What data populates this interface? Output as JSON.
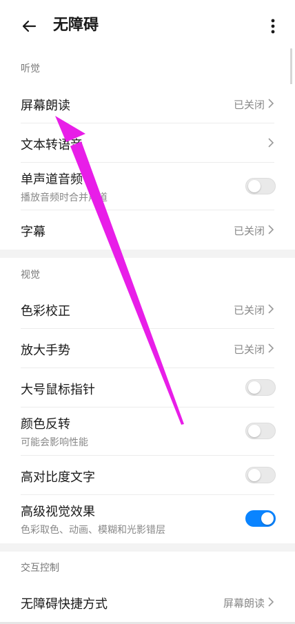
{
  "header": {
    "title": "无障碍"
  },
  "sections": {
    "hearing": "听觉",
    "vision": "视觉",
    "interaction": "交互控制"
  },
  "hearing_items": [
    {
      "title": "屏幕朗读",
      "status": "已关闭"
    },
    {
      "title": "文本转语音"
    },
    {
      "title": "单声道音频",
      "subtitle": "播放音频时合并声道",
      "toggle": "off"
    },
    {
      "title": "字幕",
      "status": "已关闭"
    }
  ],
  "vision_items": [
    {
      "title": "色彩校正",
      "status": "已关闭"
    },
    {
      "title": "放大手势",
      "status": "已关闭"
    },
    {
      "title": "大号鼠标指针",
      "toggle": "off"
    },
    {
      "title": "颜色反转",
      "subtitle": "可能会影响性能",
      "toggle": "off"
    },
    {
      "title": "高对比度文字",
      "toggle": "off"
    },
    {
      "title": "高级视觉效果",
      "subtitle": "色彩取色、动画、模糊和光影错层",
      "toggle": "on"
    }
  ],
  "interaction_items": [
    {
      "title": "无障碍快捷方式",
      "status": "屏幕朗读"
    }
  ],
  "colors": {
    "accent": "#0a84ff",
    "annotation_arrow": "#e81ee8"
  }
}
